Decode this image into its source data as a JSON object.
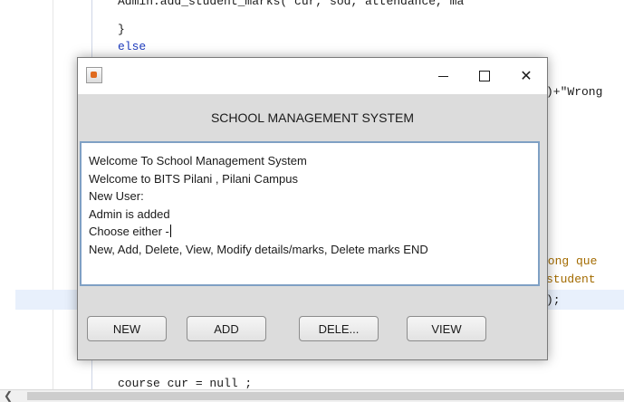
{
  "editor": {
    "code_lines": [
      {
        "indent": "      ",
        "text": "Admin.add_student_marks( cur, sod, attendance, ma"
      },
      {
        "indent": "    ",
        "text": "}"
      },
      {
        "indent": "    ",
        "text": "else"
      },
      {
        "text": ")+\"Wrong"
      },
      {
        "text": "rong que"
      },
      {
        "text": "student"
      },
      {
        "text": ");"
      },
      {
        "text": "course cur = null ;"
      }
    ]
  },
  "window": {
    "title_buttons": {
      "minimize": "—",
      "maximize": "☐",
      "close": "✕"
    },
    "header": "SCHOOL MANAGEMENT SYSTEM",
    "output_lines": [
      "Welcome To School Management System",
      "Welcome to BITS Pilani , Pilani Campus",
      "New User:",
      "Admin is added",
      "Choose either -",
      "New, Add, Delete, View, Modify details/marks, Delete marks END"
    ],
    "buttons": {
      "new": "NEW",
      "add": "ADD",
      "delete": "DELE...",
      "view": "VIEW"
    }
  }
}
